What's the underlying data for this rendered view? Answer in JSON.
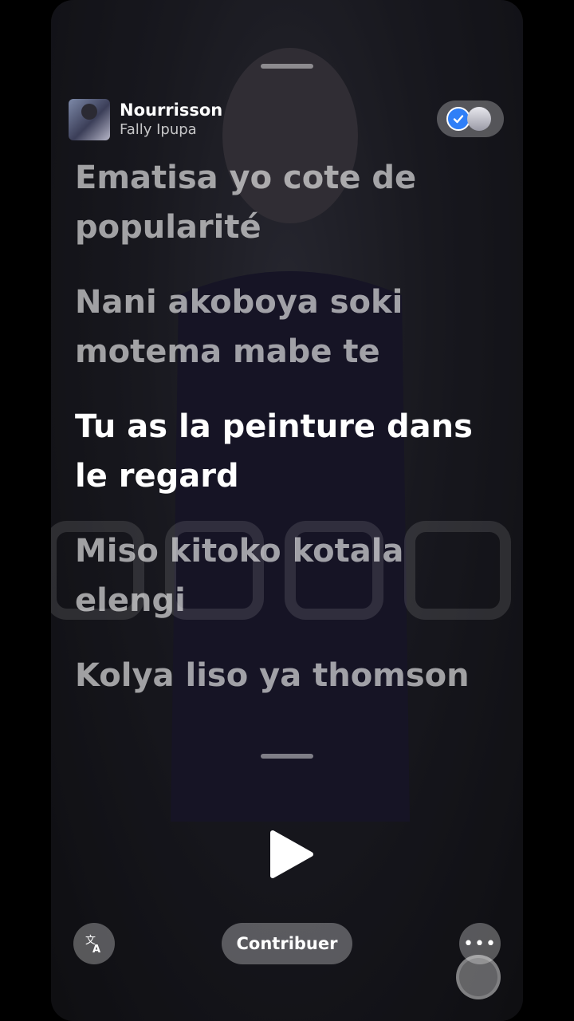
{
  "track": {
    "title": "Nourrisson",
    "artist": "Fally Ipupa"
  },
  "lyrics": [
    {
      "text": "Ematisa yo cote de popularité",
      "state": "past"
    },
    {
      "text": "Nani akoboya soki motema mabe te",
      "state": "upcoming"
    },
    {
      "text": "Tu as la peinture dans le regard",
      "state": "active"
    },
    {
      "text": "Miso kitoko kotala elengi",
      "state": "upcoming"
    },
    {
      "text": "Kolya liso ya thomson",
      "state": "upcoming"
    }
  ],
  "controls": {
    "contribute_label": "Contribuer",
    "play_icon": "play-icon",
    "translate_icon": "translate-icon",
    "more_icon": "more-icon"
  },
  "colors": {
    "accent": "#2f7ff7",
    "lyric_active": "#ffffff",
    "lyric_dim": "rgba(255,255,255,0.6)"
  }
}
